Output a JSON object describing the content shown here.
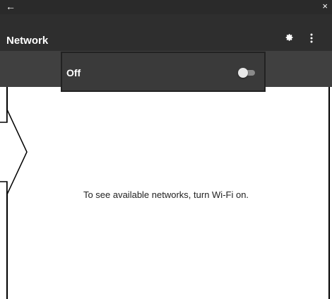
{
  "titlebar": {
    "back_icon": "arrow-left-icon",
    "close_icon": "close-icon",
    "back_glyph": "←",
    "close_glyph": "×"
  },
  "appbar": {
    "title": "Network",
    "settings_icon": "gear-icon",
    "more_icon": "more-vert-icon"
  },
  "wifi_switch": {
    "label": "Off",
    "state": "off"
  },
  "main": {
    "message": "To see available networks, turn Wi-Fi on."
  },
  "colors": {
    "titlebar": "#2a2a2a",
    "appbar": "#2e2e2e",
    "subbar": "#404040",
    "card": "#3a3a3a"
  }
}
